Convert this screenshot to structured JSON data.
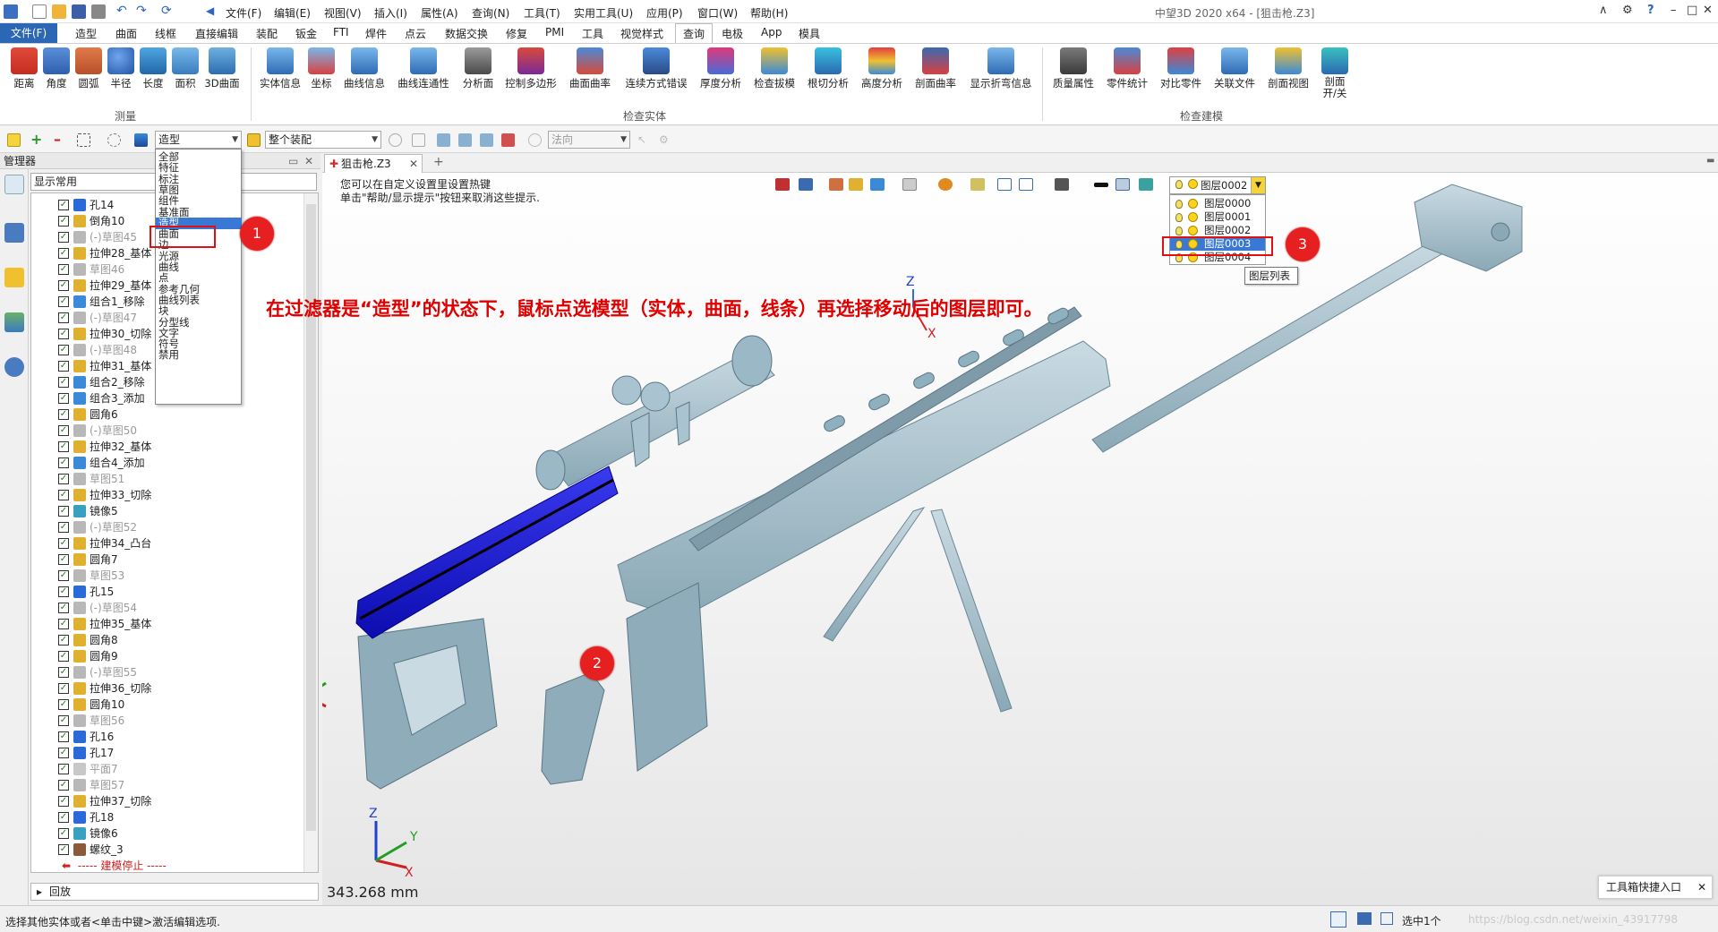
{
  "titlebar": {
    "menus": [
      "文件(F)",
      "编辑(E)",
      "视图(V)",
      "插入(I)",
      "属性(A)",
      "查询(N)",
      "工具(T)",
      "实用工具(U)",
      "应用(P)",
      "窗口(W)",
      "帮助(H)"
    ],
    "app_title": "中望3D 2020 x64 - [狙击枪.Z3]",
    "window_buttons": [
      "∧",
      "⚙",
      "?",
      "–",
      "□",
      "✕"
    ]
  },
  "tabs": {
    "file": "文件(F)",
    "items": [
      "造型",
      "曲面",
      "线框",
      "直接编辑",
      "装配",
      "钣金",
      "FTI",
      "焊件",
      "点云",
      "数据交换",
      "修复",
      "PMI",
      "工具",
      "视觉样式",
      "查询",
      "电极",
      "App",
      "模具"
    ],
    "active": "查询"
  },
  "ribbon": {
    "groups": [
      {
        "label": "测量",
        "buttons": [
          "距离",
          "角度",
          "圆弧",
          "半径",
          "长度",
          "面积",
          "3D曲面"
        ]
      },
      {
        "label": "检查实体",
        "buttons": [
          "实体信息",
          "坐标",
          "曲线信息",
          "曲线连通性",
          "分析面",
          "控制多边形",
          "曲面曲率",
          "连续方式错误",
          "厚度分析",
          "检查拔模",
          "根切分析",
          "高度分析",
          "剖面曲率",
          "显示折弯信息"
        ]
      },
      {
        "label": "检查建模",
        "buttons": [
          "质量属性",
          "零件统计",
          "对比零件",
          "关联文件",
          "剖面视图",
          "剖面 开/关"
        ]
      }
    ]
  },
  "toolbar2": {
    "filter_value": "造型",
    "assembly_value": "整个装配",
    "direction_placeholder": "法向"
  },
  "filter_dropdown": {
    "options": [
      "全部",
      "特征",
      "标注",
      "草图",
      "组件",
      "基准面",
      "造型",
      "曲面",
      "边",
      "光源",
      "曲线",
      "点",
      "参考几何",
      "曲线列表",
      "块",
      "分型线",
      "文字",
      "符号",
      "禁用"
    ],
    "selected": "造型"
  },
  "manager": {
    "title": "管理器",
    "filter_label": "显示常用",
    "rows": [
      {
        "label": "孔14",
        "dim": false,
        "icon": "hole"
      },
      {
        "label": "倒角10",
        "dim": false,
        "icon": "chamfer"
      },
      {
        "label": "(-)草图45",
        "dim": true,
        "icon": "sketch"
      },
      {
        "label": "拉伸28_基体",
        "dim": false,
        "icon": "extrude"
      },
      {
        "label": "草图46",
        "dim": true,
        "icon": "sketch"
      },
      {
        "label": "拉伸29_基体",
        "dim": false,
        "icon": "extrude"
      },
      {
        "label": "组合1_移除",
        "dim": false,
        "icon": "combine"
      },
      {
        "label": "(-)草图47",
        "dim": true,
        "icon": "sketch"
      },
      {
        "label": "拉伸30_切除",
        "dim": false,
        "icon": "extrude"
      },
      {
        "label": "(-)草图48",
        "dim": true,
        "icon": "sketch"
      },
      {
        "label": "拉伸31_基体",
        "dim": false,
        "icon": "extrude"
      },
      {
        "label": "组合2_移除",
        "dim": false,
        "icon": "combine"
      },
      {
        "label": "组合3_添加",
        "dim": false,
        "icon": "combine"
      },
      {
        "label": "圆角6",
        "dim": false,
        "icon": "fillet"
      },
      {
        "label": "(-)草图50",
        "dim": true,
        "icon": "sketch"
      },
      {
        "label": "拉伸32_基体",
        "dim": false,
        "icon": "extrude"
      },
      {
        "label": "组合4_添加",
        "dim": false,
        "icon": "combine"
      },
      {
        "label": "草图51",
        "dim": true,
        "icon": "sketch"
      },
      {
        "label": "拉伸33_切除",
        "dim": false,
        "icon": "extrude"
      },
      {
        "label": "镜像5",
        "dim": false,
        "icon": "mirror"
      },
      {
        "label": "(-)草图52",
        "dim": true,
        "icon": "sketch"
      },
      {
        "label": "拉伸34_凸台",
        "dim": false,
        "icon": "extrude"
      },
      {
        "label": "圆角7",
        "dim": false,
        "icon": "fillet"
      },
      {
        "label": "草图53",
        "dim": true,
        "icon": "sketch"
      },
      {
        "label": "孔15",
        "dim": false,
        "icon": "hole"
      },
      {
        "label": "(-)草图54",
        "dim": true,
        "icon": "sketch"
      },
      {
        "label": "拉伸35_基体",
        "dim": false,
        "icon": "extrude"
      },
      {
        "label": "圆角8",
        "dim": false,
        "icon": "fillet"
      },
      {
        "label": "圆角9",
        "dim": false,
        "icon": "fillet"
      },
      {
        "label": "(-)草图55",
        "dim": true,
        "icon": "sketch"
      },
      {
        "label": "拉伸36_切除",
        "dim": false,
        "icon": "extrude"
      },
      {
        "label": "圆角10",
        "dim": false,
        "icon": "fillet"
      },
      {
        "label": "草图56",
        "dim": true,
        "icon": "sketch"
      },
      {
        "label": "孔16",
        "dim": false,
        "icon": "hole"
      },
      {
        "label": "孔17",
        "dim": false,
        "icon": "hole"
      },
      {
        "label": "平面7",
        "dim": true,
        "icon": "plane"
      },
      {
        "label": "草图57",
        "dim": true,
        "icon": "sketch"
      },
      {
        "label": "拉伸37_切除",
        "dim": false,
        "icon": "extrude"
      },
      {
        "label": "孔18",
        "dim": false,
        "icon": "hole"
      },
      {
        "label": "镜像6",
        "dim": false,
        "icon": "mirror"
      },
      {
        "label": "螺纹_3",
        "dim": false,
        "icon": "thread"
      }
    ],
    "stop_label": "----- 建模停止 -----",
    "playback_label": "回放"
  },
  "viewport": {
    "doc_tab": "狙击枪.Z3",
    "hint_line1": "您可以在自定义设置里设置热键",
    "hint_line2": "单击\"帮助/显示提示\"按钮来取消这些提示.",
    "annotation": "在过滤器是“造型”的状态下，鼠标点选模型（实体，曲面，线条）再选择移动后的图层即可。",
    "scale": "343.268 mm",
    "axis_labels": {
      "z": "Z",
      "x": "X",
      "y": "Y"
    }
  },
  "layers": {
    "current": "图层0002",
    "list": [
      "图层0000",
      "图层0001",
      "图层0002",
      "图层0003",
      "图层0004"
    ],
    "selected": "图层0003",
    "tooltip": "图层列表"
  },
  "badges": [
    "1",
    "2",
    "3"
  ],
  "statusbar": {
    "text": "选择其他实体或者<单击中键>激活编辑选项.",
    "selection": "选中1个",
    "watermark": "https://blog.csdn.net/weixin_43917798"
  },
  "quick_entry": {
    "label": "工具箱快捷入口",
    "close": "✕"
  },
  "colors": {
    "accent": "#2b67b5",
    "selection_blue": "#1a1adb",
    "model": "#a9c3d0",
    "annotation_red": "#e00000"
  }
}
